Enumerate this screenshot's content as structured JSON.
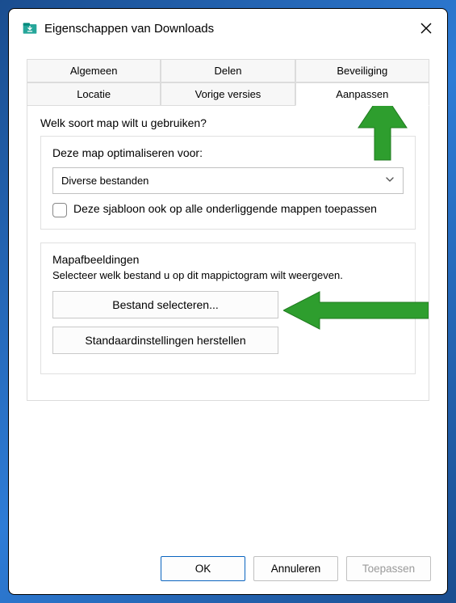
{
  "titlebar": {
    "title": "Eigenschappen van Downloads"
  },
  "tabs": {
    "general": "Algemeen",
    "sharing": "Delen",
    "security": "Beveiliging",
    "location": "Locatie",
    "previous": "Vorige versies",
    "customize": "Aanpassen"
  },
  "panel": {
    "question": "Welk soort map wilt u gebruiken?",
    "optimize_label": "Deze map optimaliseren voor:",
    "dropdown_value": "Diverse bestanden",
    "checkbox_label": "Deze sjabloon ook op alle onderliggende mappen toepassen",
    "images_title": "Mapafbeeldingen",
    "images_sub": "Selecteer welk bestand u op dit mappictogram wilt weergeven.",
    "choose_file": "Bestand selecteren...",
    "restore_defaults": "Standaardinstellingen herstellen"
  },
  "footer": {
    "ok": "OK",
    "cancel": "Annuleren",
    "apply": "Toepassen"
  }
}
